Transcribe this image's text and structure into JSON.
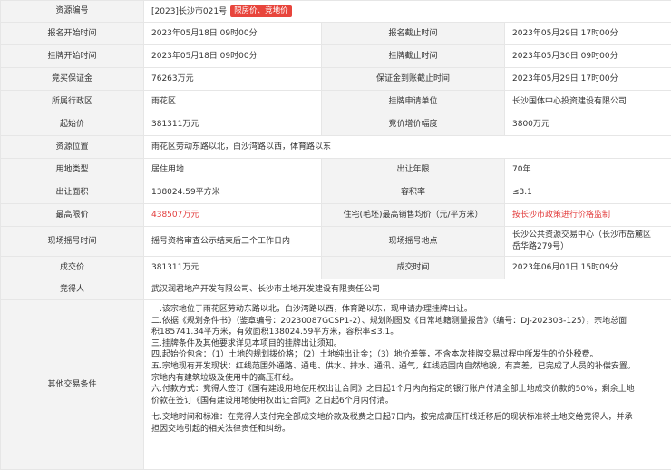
{
  "resource": {
    "label": "资源编号",
    "value": "[2023]长沙市021号",
    "badge": "限房价、竞地价"
  },
  "rows": [
    {
      "l1": "报名开始时间",
      "v1": "2023年05月18日 09时00分",
      "l2": "报名截止时间",
      "v2": "2023年05月29日 17时00分"
    },
    {
      "l1": "挂牌开始时间",
      "v1": "2023年05月18日 09时00分",
      "l2": "挂牌截止时间",
      "v2": "2023年05月30日 09时00分"
    },
    {
      "l1": "竞买保证金",
      "v1": "76263万元",
      "l2": "保证金到账截止时间",
      "v2": "2023年05月29日 17时00分"
    },
    {
      "l1": "所属行政区",
      "v1": "雨花区",
      "l2": "挂牌申请单位",
      "v2": "长沙国体中心投资建设有限公司"
    },
    {
      "l1": "起始价",
      "v1": "381311万元",
      "l2": "竞价增价幅度",
      "v2": "3800万元"
    }
  ],
  "location": {
    "label": "资源位置",
    "value": "雨花区劳动东路以北，白沙湾路以西，体育路以东"
  },
  "use": {
    "l1": "用地类型",
    "v1": "居住用地",
    "l2": "出让年限",
    "v2": "70年"
  },
  "area": {
    "l1": "出让面积",
    "v1": "138024.59平方米",
    "l2": "容积率",
    "v2": "≤3.1"
  },
  "limit": {
    "l1": "最高限价",
    "v1": "438507万元",
    "l2": "住宅(毛坯)最高销售均价（元/平方米）",
    "v2": "按长沙市政策进行价格监制"
  },
  "lottery": {
    "l1": "现场摇号时间",
    "v1": "摇号资格审查公示结束后三个工作日内",
    "l2": "现场摇号地点",
    "v2a": "长沙公共资源交易中心（长沙市岳麓区",
    "v2b": "岳华路279号）"
  },
  "deal": {
    "l1": "成交价",
    "v1": "381311万元",
    "l2": "成交时间",
    "v2": "2023年06月01日 15时09分"
  },
  "bidder": {
    "label": "竞得人",
    "value": "武汉润君地产开发有限公司、长沙市土地开发建设有限责任公司"
  },
  "other": {
    "label": "其他交易条件",
    "lines": [
      "一.该宗地位于雨花区劳动东路以北，白沙湾路以西，体育路以东，现申请办理挂牌出让。",
      "二.依据《规划条件书》（鉴章编号：20230087GCSP1-2）、规划附图及《日常地籍测量报告》（编号：DJ-202303-125），宗地总面",
      "积185741.34平方米，有效面积138024.59平方米，容积率≤3.1。",
      "三.挂牌条件及其他要求详见本项目的挂牌出让须知。",
      "四.起始价包含：（1）土地的规划拨价格；（2）土地纯出让金；（3）地价差等，不含本次挂牌交易过程中所发生的价外税费。",
      "五.宗地现有开发现状：红线范围外通路、通电、供水、排水、通讯、通气，红线范围内自然地貌，有高差，已完成了人员的补偿安置。",
      "宗地内有建筑垃圾及使用中的高压杆线。",
      "六.付款方式：竞得人签订《国有建设用地使用权出让合同》之日起1个月内向指定的银行账户付清全部土地成交价款的50%，剩余土地",
      "价款在签订《国有建设用地使用权出让合同》之日起6个月内付清。",
      "七.交地时间和标准：在竞得人支付完全部成交地价款及税费之日起7日内，按完成高压杆线迁移后的现状标准将土地交给竞得人，并承",
      "担因交地引起的相关法律责任和纠纷。"
    ]
  }
}
